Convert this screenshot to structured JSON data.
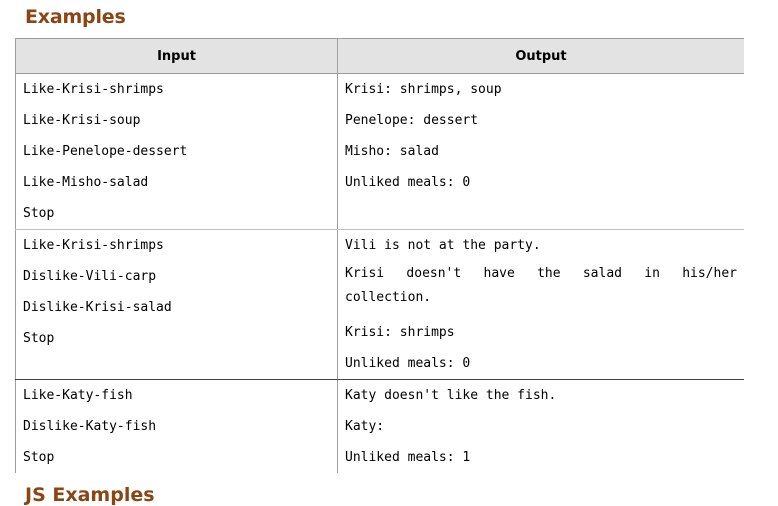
{
  "heading": "Examples",
  "next_heading": "JS Examples",
  "table": {
    "headers": [
      "Input",
      "Output"
    ],
    "examples": [
      {
        "input": [
          "Like-Krisi-shrimps",
          "Like-Krisi-soup",
          "Like-Penelope-dessert",
          "Like-Misho-salad",
          "Stop"
        ],
        "output": [
          "Krisi: shrimps, soup",
          "Penelope: dessert",
          "Misho: salad",
          "Unliked meals: 0"
        ]
      },
      {
        "input": [
          "Like-Krisi-shrimps",
          "Dislike-Vili-carp",
          "Dislike-Krisi-salad",
          "Stop"
        ],
        "output": [
          "Vili is not at the party.",
          "Krisi doesn't have the salad in his/her",
          "collection.",
          "Krisi: shrimps",
          "Unliked meals: 0"
        ]
      },
      {
        "input": [
          "Like-Katy-fish",
          "Dislike-Katy-fish",
          "Stop"
        ],
        "output": [
          "Katy doesn't like the fish.",
          "Katy:",
          "Unliked meals: 1"
        ]
      }
    ]
  }
}
